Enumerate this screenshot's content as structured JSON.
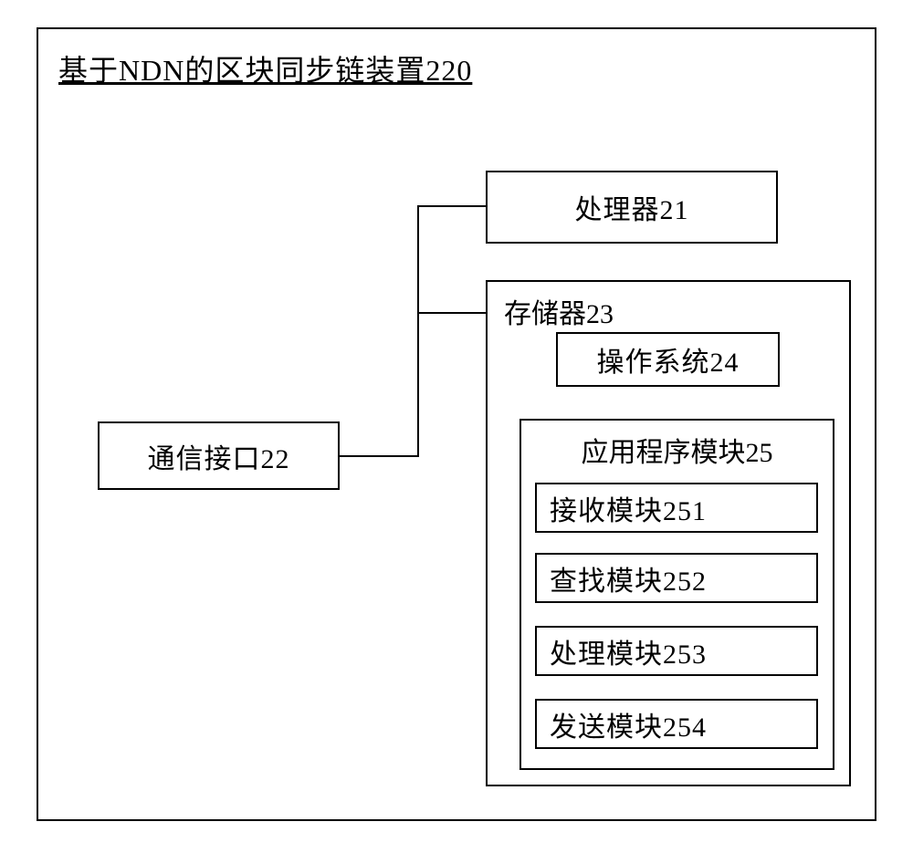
{
  "title": "基于NDN的区块同步链装置220",
  "processor": {
    "label": "处理器21"
  },
  "comm_interface": {
    "label": "通信接口22"
  },
  "memory": {
    "label": "存储器23",
    "os": {
      "label": "操作系统24"
    },
    "app_module": {
      "label": "应用程序模块25",
      "sub_modules": [
        {
          "label": "接收模块251"
        },
        {
          "label": "查找模块252"
        },
        {
          "label": "处理模块253"
        },
        {
          "label": "发送模块254"
        }
      ]
    }
  }
}
